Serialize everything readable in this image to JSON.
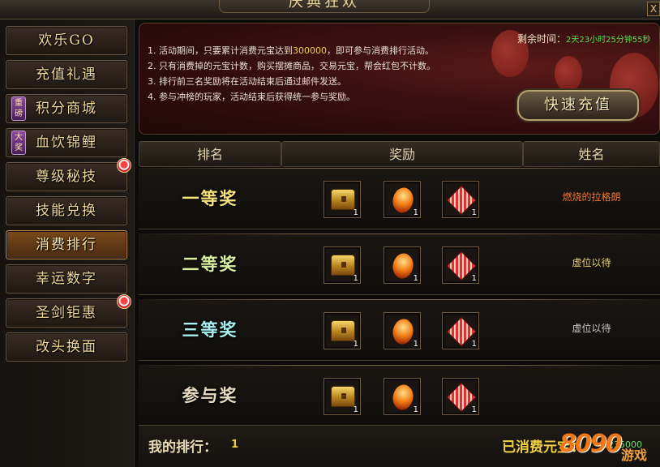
{
  "window": {
    "title": "庆典狂欢",
    "close_label": "X"
  },
  "sidebar": {
    "items": [
      {
        "label": "欢乐GO"
      },
      {
        "label": "充值礼遇"
      },
      {
        "label": "积分商城",
        "badge": "重磅"
      },
      {
        "label": "血饮锦鲤",
        "badge": "大奖"
      },
      {
        "label": "尊级秘技"
      },
      {
        "label": "技能兑换"
      },
      {
        "label": "消费排行",
        "active": true
      },
      {
        "label": "幸运数字"
      },
      {
        "label": "圣剑钜惠"
      },
      {
        "label": "改头换面"
      }
    ]
  },
  "banner": {
    "rules": [
      {
        "prefix": "1. 活动期间，只要累计消费元宝达到",
        "highlight": "300000",
        "suffix": "，即可参与消费排行活动。"
      },
      {
        "prefix": "2. 只有消费掉的元宝计数，购买摆摊商品，交易元宝，帮会红包不计数。",
        "highlight": "",
        "suffix": ""
      },
      {
        "prefix": "3. 排行前三名奖励将在活动结束后通过邮件发送。",
        "highlight": "",
        "suffix": ""
      },
      {
        "prefix": "4. 参与冲榜的玩家，活动结束后获得统一参与奖励。",
        "highlight": "",
        "suffix": ""
      }
    ],
    "countdown_label": "剩余时间：",
    "countdown_value": "2天23小时25分钟55秒",
    "recharge_button": "快速充值"
  },
  "table": {
    "headers": [
      "排名",
      "奖励",
      "姓名"
    ],
    "rows": [
      {
        "prize": "一等奖",
        "color": "#f6e27a",
        "items": [
          {
            "icon": "treasure-chest",
            "qty": "1"
          },
          {
            "icon": "fire-gem",
            "qty": "1"
          },
          {
            "icon": "red-crystal",
            "qty": "1"
          }
        ],
        "winner": "燃烧的拉格朗",
        "winner_color": "#e8783a"
      },
      {
        "prize": "二等奖",
        "color": "#d8f0a0",
        "items": [
          {
            "icon": "treasure-chest",
            "qty": "1"
          },
          {
            "icon": "fire-gem",
            "qty": "1"
          },
          {
            "icon": "red-crystal",
            "qty": "1"
          }
        ],
        "winner": "虚位以待",
        "winner_color": "#e8d070"
      },
      {
        "prize": "三等奖",
        "color": "#a8f0f0",
        "items": [
          {
            "icon": "treasure-chest",
            "qty": "1"
          },
          {
            "icon": "fire-gem",
            "qty": "1"
          },
          {
            "icon": "red-crystal",
            "qty": "1"
          }
        ],
        "winner": "虚位以待",
        "winner_color": "#c8c8c8"
      },
      {
        "prize": "参与奖",
        "color": "#e8dcc0",
        "items": [
          {
            "icon": "treasure-chest",
            "qty": "1"
          },
          {
            "icon": "fire-gem",
            "qty": "1"
          },
          {
            "icon": "red-crystal",
            "qty": "1"
          }
        ],
        "winner": "",
        "winner_color": "#c8c8c8"
      }
    ]
  },
  "footer": {
    "my_rank_label": "我的排行：",
    "my_rank_value": "1",
    "spent_label": "已消费元宝：",
    "spent_value": "1235000"
  },
  "watermark": {
    "number": "8090",
    "text": "游戏"
  }
}
